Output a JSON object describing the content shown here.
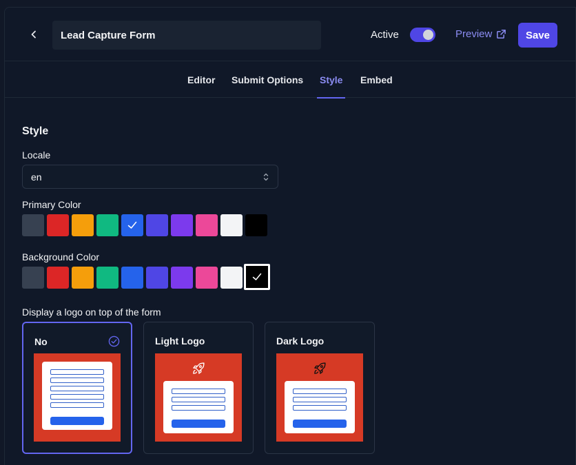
{
  "header": {
    "form_title": "Lead Capture Form",
    "active_label": "Active",
    "active_on": true,
    "preview_label": "Preview",
    "save_label": "Save"
  },
  "tabs": [
    {
      "label": "Editor",
      "active": false
    },
    {
      "label": "Submit Options",
      "active": false
    },
    {
      "label": "Style",
      "active": true
    },
    {
      "label": "Embed",
      "active": false
    }
  ],
  "style": {
    "section_title": "Style",
    "locale_label": "Locale",
    "locale_value": "en",
    "primary_color_label": "Primary Color",
    "background_color_label": "Background Color",
    "primary_colors": [
      "#374151",
      "#dc2626",
      "#f59e0b",
      "#10b981",
      "#2563eb",
      "#4f46e5",
      "#7c3aed",
      "#ec4899",
      "#f3f4f6",
      "#000000"
    ],
    "primary_selected": "#2563eb",
    "background_colors": [
      "#374151",
      "#dc2626",
      "#f59e0b",
      "#10b981",
      "#2563eb",
      "#4f46e5",
      "#7c3aed",
      "#ec4899",
      "#f3f4f6",
      "#000000"
    ],
    "background_selected": "#000000",
    "logo_label": "Display a logo on top of the form",
    "logo_options": [
      {
        "label": "No",
        "selected": true
      },
      {
        "label": "Light Logo",
        "selected": false
      },
      {
        "label": "Dark Logo",
        "selected": false
      }
    ]
  },
  "colors": {
    "accent": "#4f46e5",
    "preview_bg": "#d63a25",
    "form_button": "#2563eb"
  }
}
